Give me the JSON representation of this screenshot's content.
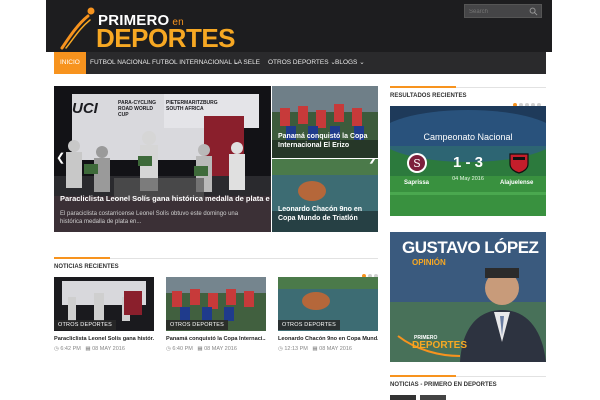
{
  "header": {
    "logo_top": "PRIMERO",
    "logo_en": "en",
    "logo_main": "DEPORTES"
  },
  "nav": {
    "items": [
      {
        "label": "INICIO",
        "active": true
      },
      {
        "label": "FUTBOL NACIONAL"
      },
      {
        "label": "FUTBOL INTERNACIONAL ⌄"
      },
      {
        "label": "LA SELE"
      },
      {
        "label": "OTROS DEPORTES ⌄"
      },
      {
        "label": "BLOGS ⌄"
      }
    ],
    "search_placeholder": "Search"
  },
  "slider": {
    "main_title": "Paracliclista Leonel Solís gana histórica medalla de plata en...",
    "main_desc": "El paraciclista costarricense Leonel Solís obtuvo este domingo una histórica medalla de plata en...",
    "banner_text_1": "UCI",
    "banner_text_2": "PARA-CYCLING ROAD WORLD CUP",
    "banner_text_3": "PIETERMARITZBURG SOUTH AFRICA",
    "side": [
      {
        "title": "Panamá conquistó la Copa Internacional El Erizo"
      },
      {
        "title": "Leonardo Chacón 9no en Copa Mundo de Triatlón"
      }
    ]
  },
  "recent_news": {
    "title": "NOTICIAS RECIENTES",
    "cards": [
      {
        "tag": "OTROS DEPORTES",
        "title": "Paracliclista Leonel Solís gana histór...",
        "time": "6:42 PM",
        "date": "08 MAY 2016"
      },
      {
        "tag": "OTROS DEPORTES",
        "title": "Panamá conquistó la Copa Internaci...",
        "time": "6:40 PM",
        "date": "08 MAY 2016"
      },
      {
        "tag": "OTROS DEPORTES",
        "title": "Leonardo Chacón 9no en Copa Mund...",
        "time": "12:13 PM",
        "date": "08 MAY 2016"
      }
    ]
  },
  "results": {
    "title": "RESULTADOS RECIENTES",
    "competition": "Campeonato Nacional",
    "home": "Saprissa",
    "away": "Alajuelense",
    "score": "1 - 3",
    "date": "04 May 2016"
  },
  "opinion": {
    "name": "GUSTAVO LÓPEZ",
    "label": "OPINIÓN",
    "brand_top": "PRIMERO",
    "brand_main": "DEPORTES"
  },
  "bottom": {
    "title": "NOTICIAS - PRIMERO EN DEPORTES"
  },
  "colors": {
    "accent": "#f7931e",
    "header_bg": "#1d1d1f",
    "nav_bg": "#2a2a2c"
  }
}
